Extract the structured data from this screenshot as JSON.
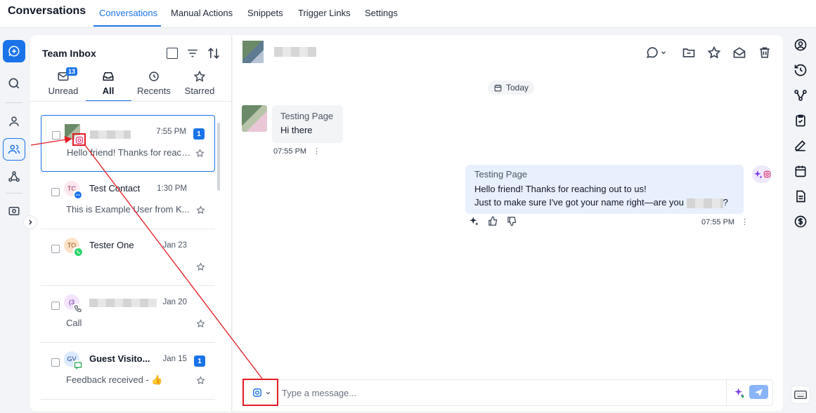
{
  "app": {
    "title": "Conversations"
  },
  "nav": {
    "tabs": [
      {
        "label": "Conversations",
        "active": true
      },
      {
        "label": "Manual Actions"
      },
      {
        "label": "Snippets"
      },
      {
        "label": "Trigger Links"
      },
      {
        "label": "Settings"
      }
    ]
  },
  "left_rail": {
    "items": [
      "new-conversation-icon",
      "search-icon",
      "contact-icon",
      "team-inbox-icon",
      "workflow-icon",
      "preview-icon"
    ],
    "selected": "team-inbox-icon"
  },
  "inbox": {
    "title": "Team Inbox",
    "filter_tabs": [
      {
        "label": "Unread",
        "badge": "13",
        "icon": "inbox-icon"
      },
      {
        "label": "All",
        "active": true,
        "icon": "tray-icon"
      },
      {
        "label": "Recents",
        "icon": "clock-icon"
      },
      {
        "label": "Starred",
        "icon": "star-icon"
      }
    ],
    "conversations": [
      {
        "avatar": "",
        "name": "",
        "time": "7:55 PM",
        "unread": "1",
        "preview": "Hello friend! Thanks for reaching out to us!",
        "channel": "instagram-icon",
        "selected": true
      },
      {
        "avatar": "TC",
        "name": "Test Contact",
        "time": "1:30 PM",
        "unread": "",
        "preview": "This is Example User from K...",
        "channel": "chat-icon"
      },
      {
        "avatar": "TO",
        "name": "Tester One",
        "time": "Jan 23",
        "unread": "",
        "preview": "",
        "channel": "whatsapp-icon"
      },
      {
        "avatar": "(3",
        "name": "",
        "time": "Jan 20",
        "unread": "",
        "preview": "Call",
        "channel": "phone-icon"
      },
      {
        "avatar": "GV",
        "name": "Guest Visito...",
        "time": "Jan 15",
        "unread": "1",
        "preview": "Feedback received - 👍",
        "channel": "live-chat-icon"
      }
    ]
  },
  "chat": {
    "date_label": "Today",
    "incoming": {
      "sender": "Testing Page",
      "text": "Hi there",
      "time": "07:55 PM"
    },
    "outgoing": {
      "sender": "Testing Page",
      "line1": "Hello friend! Thanks for reaching out to us!",
      "line2": "Just to make sure I've got your name right—are you",
      "line2_end": "?",
      "time": "07:55 PM"
    },
    "composer": {
      "placeholder": "Type a message...",
      "channel": "instagram-icon"
    }
  },
  "colors": {
    "accent": "#1a73e8",
    "annotation": "#e31b23",
    "instagram": "#e1306c"
  }
}
